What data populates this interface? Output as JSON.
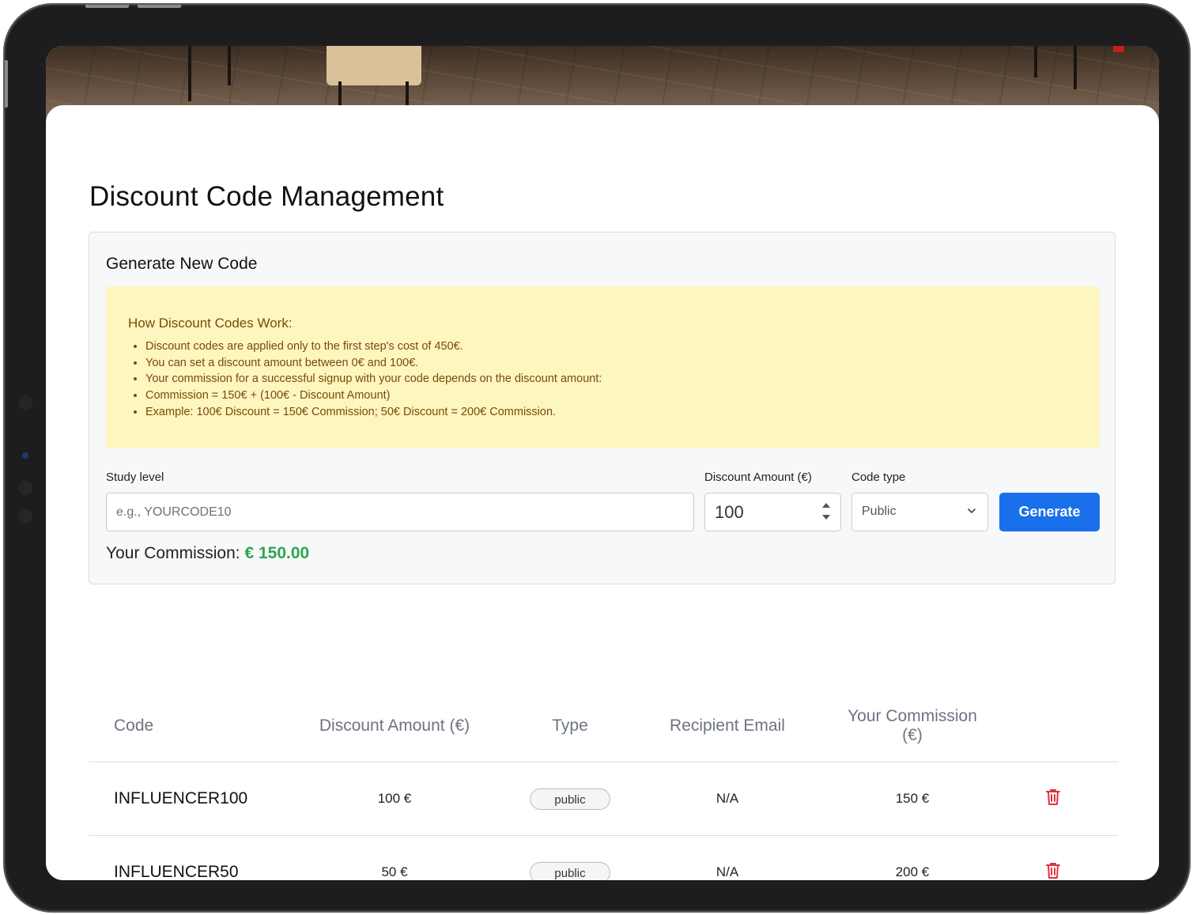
{
  "page": {
    "title": "Discount Code Management"
  },
  "generate": {
    "title": "Generate New Code",
    "info": {
      "title": "How Discount Codes Work:",
      "items": [
        "Discount codes are applied only to the first step's cost of 450€.",
        "You can set a discount amount between 0€ and 100€.",
        "Your commission for a successful signup with your code depends on the discount amount:",
        "Commission = 150€ + (100€ - Discount Amount)",
        "Example: 100€ Discount = 150€ Commission; 50€ Discount = 200€ Commission."
      ],
      "text_color": "#7a4a0c",
      "background": "#fdf6be"
    },
    "study_level": {
      "label": "Study level",
      "placeholder": "e.g., YOURCODE10",
      "value": ""
    },
    "discount_amount": {
      "label": "Discount Amount (€)",
      "value": "100"
    },
    "code_type": {
      "label": "Code type",
      "value": "Public"
    },
    "button_label": "Generate",
    "button_color": "#1a6fea",
    "commission": {
      "label": "Your Commission:",
      "value": "€ 150.00",
      "color": "#2ea44f"
    }
  },
  "codes_table": {
    "headers": [
      "Code",
      "Discount Amount (€)",
      "Type",
      "Recipient Email",
      "Your Commission (€)"
    ],
    "rows": [
      {
        "code": "INFLUENCER100",
        "discount": "100 €",
        "type": "public",
        "email": "N/A",
        "commission": "150 €"
      },
      {
        "code": "INFLUENCER50",
        "discount": "50 €",
        "type": "public",
        "email": "N/A",
        "commission": "200 €"
      }
    ],
    "delete_icon": "trash-icon",
    "delete_color": "#e0313d"
  }
}
